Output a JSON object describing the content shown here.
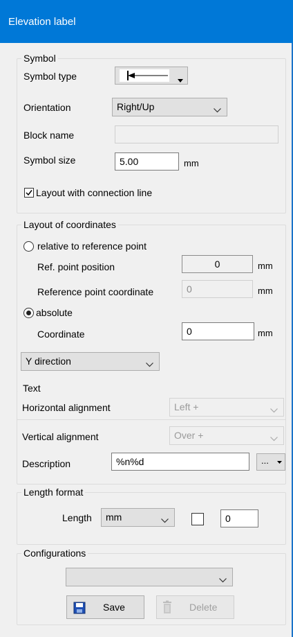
{
  "window": {
    "title": "Elevation label"
  },
  "symbol": {
    "group_title": "Symbol",
    "symbol_type_label": "Symbol type",
    "orientation_label": "Orientation",
    "orientation_value": "Right/Up",
    "block_name_label": "Block name",
    "block_name_value": "",
    "symbol_size_label": "Symbol size",
    "symbol_size_value": "5.00",
    "symbol_size_unit": "mm",
    "connection_line_label": "Layout with connection line",
    "connection_line_checked": true
  },
  "coordinates": {
    "group_title": "Layout of coordinates",
    "relative_label": "relative to reference point",
    "ref_point_position_label": "Ref. point position",
    "ref_point_position_value": "0",
    "ref_point_position_unit": "mm",
    "ref_point_coordinate_label": "Reference point coordinate",
    "ref_point_coordinate_value": "0",
    "ref_point_coordinate_unit": "mm",
    "absolute_label": "absolute",
    "coordinate_label": "Coordinate",
    "coordinate_value": "0",
    "coordinate_unit": "mm",
    "direction_value": "Y direction"
  },
  "text": {
    "group_title": "Text",
    "horizontal_label": "Horizontal alignment",
    "horizontal_value": "Left +",
    "vertical_label": "Vertical alignment",
    "vertical_value": "Over +",
    "description_label": "Description",
    "description_value": "%n%d",
    "more_button": "..."
  },
  "length_format": {
    "group_title": "Length format",
    "length_label": "Length",
    "unit_value": "mm",
    "decimals_value": "0"
  },
  "configurations": {
    "group_title": "Configurations",
    "selected_value": "",
    "save_label": "Save",
    "delete_label": "Delete"
  },
  "colors": {
    "titlebar": "#0078d7",
    "panel": "#f0f0f0"
  }
}
